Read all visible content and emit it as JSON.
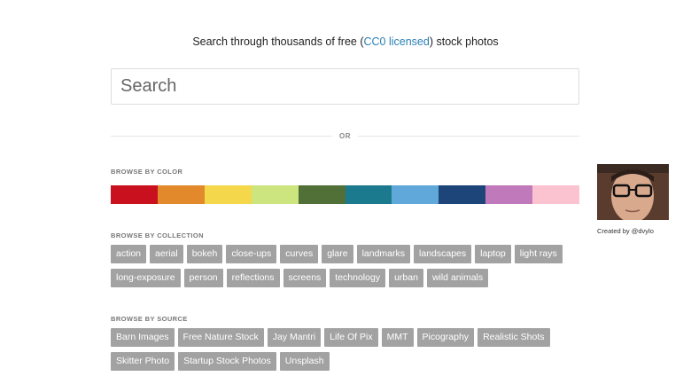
{
  "header": {
    "tagline_before": "Search through thousands of free (",
    "tagline_link": "CC0 licensed",
    "tagline_after": ") stock photos"
  },
  "search": {
    "placeholder": "Search",
    "value": ""
  },
  "divider": {
    "or_label": "OR"
  },
  "color_section": {
    "label": "BROWSE BY COLOR",
    "colors": [
      "#c8101f",
      "#e2892c",
      "#f4d74a",
      "#cde57f",
      "#507038",
      "#1c7a8e",
      "#61a8da",
      "#1e4579",
      "#c07abb",
      "#fbc2cf"
    ]
  },
  "collection_section": {
    "label": "BROWSE BY COLLECTION",
    "rows": [
      [
        "action",
        "aerial",
        "bokeh",
        "close-ups",
        "curves",
        "glare",
        "landmarks",
        "landscapes",
        "laptop",
        "light rays"
      ],
      [
        "long-exposure",
        "person",
        "reflections",
        "screens",
        "technology",
        "urban",
        "wild animals"
      ]
    ]
  },
  "source_section": {
    "label": "BROWSE BY SOURCE",
    "rows": [
      [
        "Barn Images",
        "Free Nature Stock",
        "Jay Mantri",
        "Life Of Pix",
        "MMT",
        "Picography",
        "Realistic Shots"
      ],
      [
        "Skitter Photo",
        "Startup Stock Photos",
        "Unsplash"
      ]
    ]
  },
  "creator": {
    "credit": "Created by @dvylo"
  }
}
